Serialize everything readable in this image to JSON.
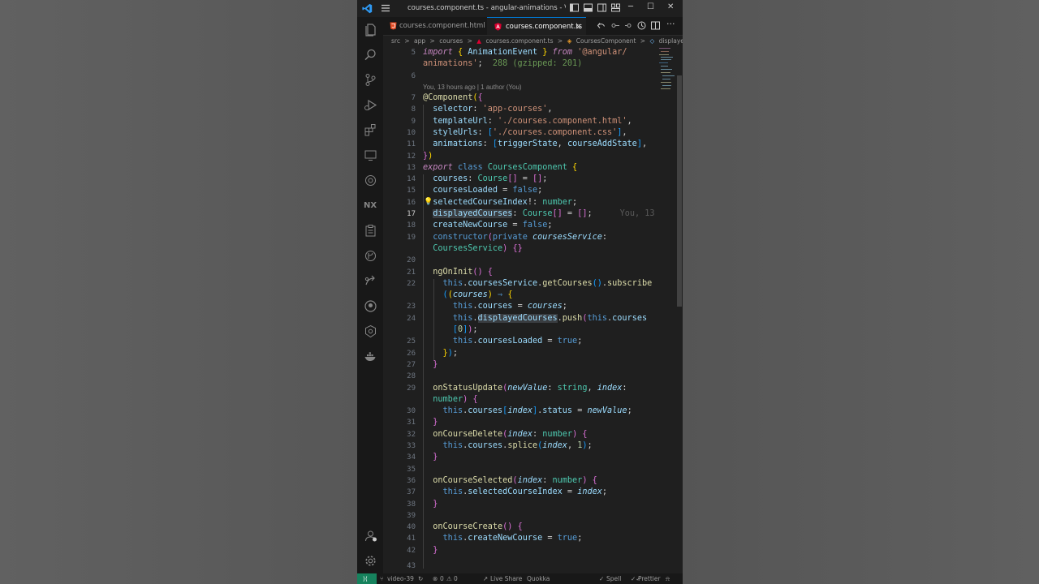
{
  "window": {
    "title": "courses.component.ts - angular-animations - Visual..."
  },
  "tabs": [
    {
      "label": "courses.component.html",
      "icon": "html-file-icon"
    },
    {
      "label": "courses.component.ts",
      "icon": "angular-file-icon",
      "close": "×"
    }
  ],
  "breadcrumb": [
    "src",
    ">",
    "app",
    ">",
    "courses",
    ">",
    "courses.component.ts",
    ">",
    "CoursesComponent",
    ">",
    "displayedCourses"
  ],
  "editor": {
    "codelens": "You, 13 hours ago | 1 author (You)",
    "inline_blame": "You, 13",
    "current_line": "17",
    "line_numbers": [
      "5",
      "6",
      "7",
      "8",
      "9",
      "10",
      "11",
      "12",
      "13",
      "14",
      "15",
      "16",
      "17",
      "18",
      "19",
      "20",
      "21",
      "22",
      "23",
      "24",
      "25",
      "26",
      "27",
      "28",
      "29",
      "30",
      "31",
      "32",
      "33",
      "34",
      "35",
      "36",
      "37",
      "38",
      "39",
      "40",
      "41",
      "42",
      "43"
    ]
  },
  "status_bar": {
    "branch": "video-39",
    "errors": "0",
    "warnings": "0",
    "live_share": "Live Share",
    "quokka": "Quokka",
    "spell": "Spell",
    "prettier": "Prettier"
  },
  "colors": {
    "accent": "#0078d4",
    "remote": "#16825d",
    "editor_bg": "#1f1f1f"
  }
}
